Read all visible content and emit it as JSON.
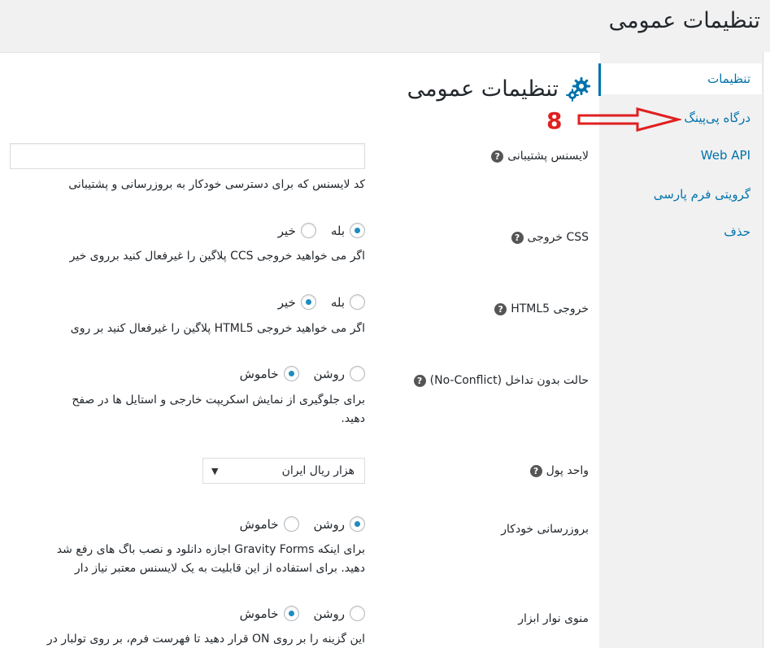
{
  "page": {
    "heading": "تنظیمات عمومی"
  },
  "nav": {
    "items": [
      {
        "label": "تنظیمات"
      },
      {
        "label": "درگاه پی‌پینگ"
      },
      {
        "label": "Web API"
      },
      {
        "label": "گرویتی فرم پارسی"
      },
      {
        "label": "حذف"
      }
    ]
  },
  "panel": {
    "title": "تنظیمات عمومی"
  },
  "annotation": {
    "number": "8",
    "color": "#e02020"
  },
  "fields": {
    "license": {
      "label": "لایسنس پشتیبانی",
      "value": "",
      "description": "کد لایسنس که برای دسترسی خودکار به بروزرسانی و پشتیبانی"
    },
    "css": {
      "label": "CSS خروجی",
      "options": [
        "بله",
        "خیر"
      ],
      "selected": "بله",
      "description": "اگر می خواهید خروجی CCS پلاگین را غیرفعال کنید برروی خیر"
    },
    "html5": {
      "label": "خروجی HTML5",
      "options": [
        "بله",
        "خیر"
      ],
      "selected": "خیر",
      "description": "اگر می خواهید خروجی HTML5 پلاگین را غیرفعال کنید بر روی"
    },
    "noconflict": {
      "label": "حالت بدون تداخل (No-Conflict)",
      "options": [
        "روشن",
        "خاموش"
      ],
      "selected": "خاموش",
      "description_line1": "برای جلوگیری از نمایش اسکریپت خارجی و استایل ها در صفح",
      "description_line2": "دهید."
    },
    "currency": {
      "label": "واحد پول",
      "selected": "هزار ریال ایران"
    },
    "autoupdate": {
      "label": "بروزرسانی خودکار",
      "options": [
        "روشن",
        "خاموش"
      ],
      "selected": "روشن",
      "description_line1": "برای اینکه Gravity Forms اجازه دانلود و نصب باگ های رفع شد",
      "description_line2": "دهید. برای استفاده از این قابلیت به یک لایسنس معتبر نیاز دار"
    },
    "toolbar": {
      "label": "منوی نوار ابزار",
      "options": [
        "روشن",
        "خاموش"
      ],
      "selected": "خاموش",
      "description": "این گزینه را بر روی ON قرار دهید تا فهرست فرم، بر روی تولبار در"
    }
  },
  "colors": {
    "link": "#0073aa",
    "radio_dot": "#1e8cbe"
  }
}
